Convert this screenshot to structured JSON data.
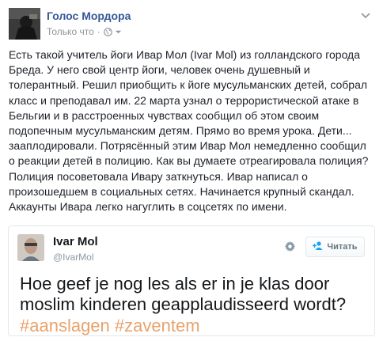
{
  "post": {
    "page_name": "Голос Мордора",
    "timestamp": "Только что",
    "separator": "·",
    "privacy_icon": "globe-icon",
    "text": "Есть такой учитель йоги Ивар Мол (Ivar Mol) из голландского города Бреда. У него свой центр йоги, человек очень душевный и толерантный. Решил приобщить к йоге мусульманских детей, собрал класс и преподавал им. 22 марта узнал о террористической атаке в Бельгии и в расстроенных чувствах сообщил об этом своим подопечным мусульманским детям. Прямо во время урока. Дети... зааплодировали. Потрясённый этим Ивар Мол немедленно сообщил о реакции детей в полицию. Как вы думаете отреагировала полиция? Полиция посоветовала Ивару заткнуться. Ивар написал о произошедшем в социальных сетях. Начинается крупный скандал. Аккаунты Ивара легко нагуглить в соцсетях по имени."
  },
  "tweet": {
    "name": "Ivar Mol",
    "handle": "@IvarMol",
    "follow_label": "Читать",
    "text": "Hoe geef je nog les als er in je klas door moslim kinderen geapplaudisseerd wordt?",
    "hashtags": [
      "#aanslagen",
      "#zaventem"
    ]
  },
  "colors": {
    "page_name": "#365899",
    "meta": "#90949c",
    "hashtag": "#e8a26b",
    "tweet_border": "#e1e8ed"
  }
}
